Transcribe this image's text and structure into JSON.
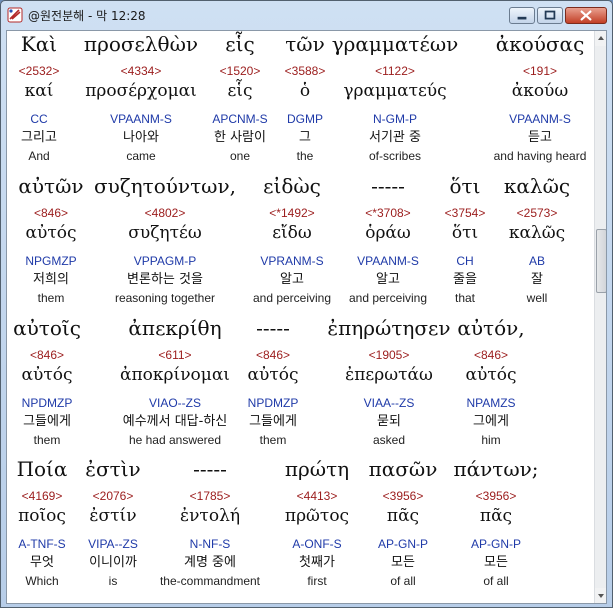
{
  "window": {
    "title": "@원전분해 - 막 12:28"
  },
  "rows": [
    {
      "words": [
        {
          "surface": "Καὶ",
          "strong": "<2532>",
          "lemma": "καί",
          "parse": "CC",
          "korean": "그리고",
          "english": "And"
        },
        {
          "surface": "προσελθὼν",
          "strong": "<4334>",
          "lemma": "προσέρχομαι",
          "parse": "VPAANM-S",
          "korean": "나아와",
          "english": "came"
        },
        {
          "surface": "εἷς",
          "strong": "<1520>",
          "lemma": "εἷς",
          "parse": "APCNM-S",
          "korean": "한 사람이",
          "english": "one"
        },
        {
          "surface": "τῶν",
          "strong": "<3588>",
          "lemma": "ὁ",
          "parse": "DGMP",
          "korean": "그",
          "english": "the"
        },
        {
          "surface": "γραμματέων",
          "strong": "<1122>",
          "lemma": "γραμματεύς",
          "parse": "N-GM-P",
          "korean": "서기관 중",
          "english": "of-scribes"
        },
        {
          "surface": "ἀκούσας",
          "strong": "<191>",
          "lemma": "ἀκούω",
          "parse": "VPAANM-S",
          "korean": "듣고",
          "english": "and having heard"
        }
      ]
    },
    {
      "words": [
        {
          "surface": "αὐτῶν",
          "strong": "<846>",
          "lemma": "αὐτός",
          "parse": "NPGMZP",
          "korean": "저희의",
          "english": "them"
        },
        {
          "surface": "συζητούντων,",
          "strong": "<4802>",
          "lemma": "συζητέω",
          "parse": "VPPAGM-P",
          "korean": "변론하는 것을",
          "english": "reasoning together"
        },
        {
          "surface": "εἰδὼς",
          "strong": "<*1492>",
          "lemma": "εἴδω",
          "parse": "VPRANM-S",
          "korean": "알고",
          "english": "and perceiving"
        },
        {
          "surface": "-----",
          "strong": "<*3708>",
          "lemma": "ὁράω",
          "parse": "VPAANM-S",
          "korean": "알고",
          "english": "and perceiving"
        },
        {
          "surface": "ὅτι",
          "strong": "<3754>",
          "lemma": "ὅτι",
          "parse": "CH",
          "korean": "줄을",
          "english": "that"
        },
        {
          "surface": "καλῶς",
          "strong": "<2573>",
          "lemma": "καλῶς",
          "parse": "AB",
          "korean": "잘",
          "english": "well"
        }
      ]
    },
    {
      "words": [
        {
          "surface": "αὐτοῖς",
          "strong": "<846>",
          "lemma": "αὐτός",
          "parse": "NPDMZP",
          "korean": "그들에게",
          "english": "them"
        },
        {
          "surface": "ἀπεκρίθη",
          "strong": "<611>",
          "lemma": "ἀποκρίνομαι",
          "parse": "VIAO--ZS",
          "korean": "예수께서 대답-하신",
          "english": "he had answered"
        },
        {
          "surface": "-----",
          "strong": "<846>",
          "lemma": "αὐτός",
          "parse": "NPDMZP",
          "korean": "그들에게",
          "english": "them"
        },
        {
          "surface": "ἐπηρώτησεν",
          "strong": "<1905>",
          "lemma": "ἐπερωτάω",
          "parse": "VIAA--ZS",
          "korean": "묻되",
          "english": "asked"
        },
        {
          "surface": "αὐτόν,",
          "strong": "<846>",
          "lemma": "αὐτός",
          "parse": "NPAMZS",
          "korean": "그에게",
          "english": "him"
        }
      ]
    },
    {
      "words": [
        {
          "surface": "Ποία",
          "strong": "<4169>",
          "lemma": "ποῖος",
          "parse": "A-TNF-S",
          "korean": "무엇",
          "english": "Which"
        },
        {
          "surface": "ἐστὶν",
          "strong": "<2076>",
          "lemma": "ἐστίν",
          "parse": "VIPA--ZS",
          "korean": "이니이까",
          "english": "is"
        },
        {
          "surface": "-----",
          "strong": "<1785>",
          "lemma": "ἐντολή",
          "parse": "N-NF-S",
          "korean": "계명 중에",
          "english": "the-commandment"
        },
        {
          "surface": "πρώτη",
          "strong": "<4413>",
          "lemma": "πρῶτος",
          "parse": "A-ONF-S",
          "korean": "첫째가",
          "english": "first"
        },
        {
          "surface": "πασῶν",
          "strong": "<3956>",
          "lemma": "πᾶς",
          "parse": "AP-GN-P",
          "korean": "모든",
          "english": "of all"
        },
        {
          "surface": "πάντων;",
          "strong": "<3956>",
          "lemma": "πᾶς",
          "parse": "AP-GN-P",
          "korean": "모든",
          "english": "of all"
        }
      ]
    }
  ]
}
